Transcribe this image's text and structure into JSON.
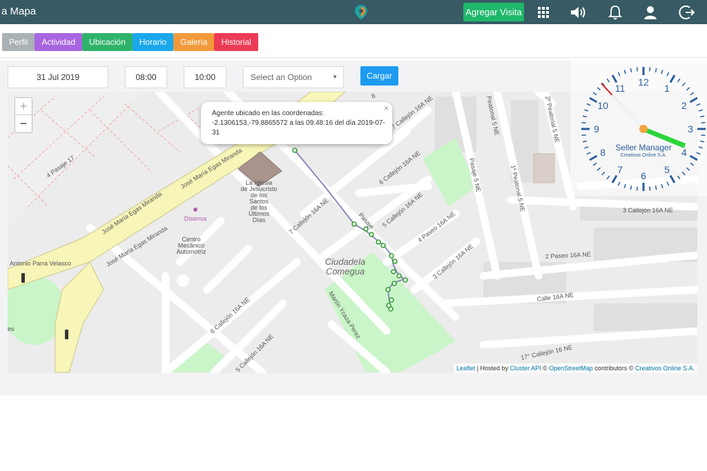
{
  "header": {
    "title": "a Mapa",
    "add_visit_label": "Agregar Visita",
    "icons": [
      "apps-grid-icon",
      "volume-icon",
      "bell-icon",
      "user-icon",
      "logout-icon"
    ],
    "brand_color": "#375a64",
    "accent_green": "#1fb86a"
  },
  "tabs": [
    {
      "label": "Perfil",
      "color": "#aab2b5"
    },
    {
      "label": "Actividad",
      "color": "#a865e0"
    },
    {
      "label": "Ubicación",
      "color": "#2fb36a"
    },
    {
      "label": "Horario",
      "color": "#1aa7ec"
    },
    {
      "label": "Galería",
      "color": "#f29a3b"
    },
    {
      "label": "Historial",
      "color": "#ec3b55"
    }
  ],
  "filters": {
    "date": "31 Jul 2019",
    "time_from": "08:00",
    "time_to": "10:00",
    "select_placeholder": "Select an Option",
    "load_label": "Cargar"
  },
  "map": {
    "zoom_in": "+",
    "zoom_out": "−",
    "popup": {
      "close": "×",
      "line1": "Agente ubicado en las coordenadas:",
      "line2": "-2.1306153,-79.8865572 a las 09:48:16 del día 2019-07-31"
    },
    "attribution": {
      "leaflet": "Leaflet",
      "hosted_by": " | Hosted by ",
      "cluster": "Cluster API",
      "copy1": " © ",
      "osm": "OpenStreetMap",
      "contributors": " contributors © ",
      "creativos": "Creativos Online S.A."
    },
    "labels": {
      "church": [
        "La Iglesia",
        "de Jesucristo",
        "de los",
        "Santos",
        "de los",
        "Últimos",
        "Días"
      ],
      "disensa": "Disensa",
      "centro": [
        "Centro",
        "Mecánico",
        "Automotriz"
      ],
      "ciudadela": [
        "Ciudadela",
        "Comegua"
      ],
      "jose1": "José María Egas Miranda",
      "jose2": "José María Egas Miranda",
      "jose3": "José María Egas Miranda",
      "antonio": "Antonio Parra Velasco",
      "pasaje17": "4 Pasaje 17",
      "c7_1": "7 Callejón 16A NE",
      "c6_1": "6 Callejón 16A NE",
      "c5_1": "5 Callejón 16A NE",
      "p4": "4 Paseo 16A NE",
      "c3_1": "3 Callejón 16A NE",
      "c7_2": "7 Callejón 16A NE",
      "c6_2": "6 Callejón 16A NE",
      "c5_2": "5 Callejón 16A NE",
      "c3_2": "3 Callejón 16A NE",
      "p2": "2 Paseo 16A NE",
      "c16": "Calle 16A NE",
      "c17": "17° Callejón 16 NE",
      "martin": "Martín Ycaza Perez",
      "pasaje": "Pasaje",
      "pasaje5": "Pasaje 5 NE",
      "peatonal": "1º Peatonal 5 NE",
      "peatonal2": "2º Peatonal 5 NE",
      "fp5": "Peatonal 5 NE",
      "b8": "8",
      "cut1": "ión 16A NE",
      "es": "es"
    }
  },
  "clock": {
    "brand": "Seller Manager",
    "company": "Creativos Online S.A.",
    "numbers": [
      "12",
      "1",
      "2",
      "3",
      "4",
      "5",
      "6",
      "7",
      "8",
      "9",
      "10",
      "11"
    ],
    "hour_color": "#2bd53a",
    "minute_color": "#ffffff",
    "second_color": "#e02020"
  }
}
